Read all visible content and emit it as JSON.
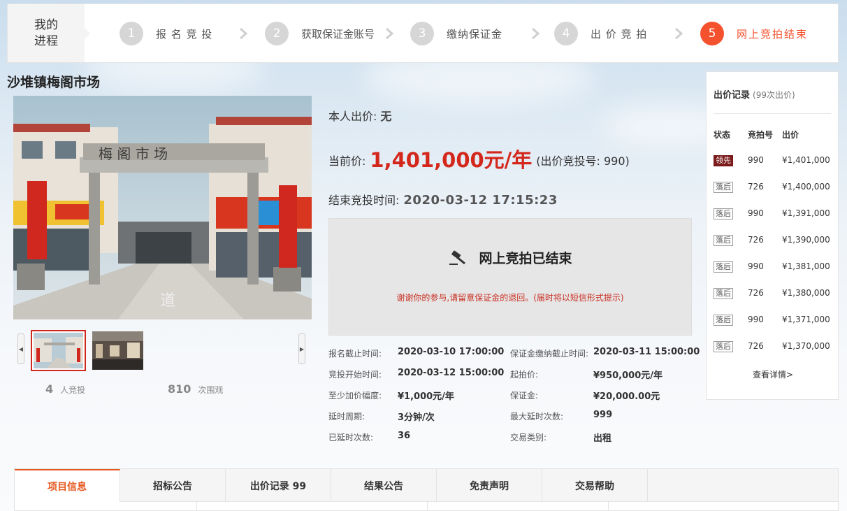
{
  "progress": {
    "heading": "我的\n进程",
    "steps": [
      {
        "num": "1",
        "label": "报 名 竞 投"
      },
      {
        "num": "2",
        "label": "获取保证金账号"
      },
      {
        "num": "3",
        "label": "缴纳保证金"
      },
      {
        "num": "4",
        "label": "出 价 竞 拍"
      },
      {
        "num": "5",
        "label": "网上竞拍结束"
      }
    ],
    "active_color": "#f4512e"
  },
  "item": {
    "title": "沙堆镇梅阁市场",
    "photo_sign": "梅 阁 市 场",
    "stats": {
      "bidders_num": "4",
      "bidders_label": "人竞投",
      "views_num": "810",
      "views_label": "次围观"
    }
  },
  "bid": {
    "my_bid_label": "本人出价:",
    "my_bid_value": "无",
    "current_label": "当前价:",
    "current_price": "1,401,000元/年",
    "current_bid_no": "(出价竞投号: 990)",
    "end_label": "结束竞投时间:",
    "end_time": "2020-03-12 17:15:23",
    "ended_title": "网上竞拍已结束",
    "ended_note": "谢谢你的参与,请留意保证金的退回。(届时将以短信形式提示)",
    "price_color": "#d4271c"
  },
  "details": [
    {
      "label": "报名截止时间:",
      "value": "2020-03-10 17:00:00"
    },
    {
      "label": "保证金缴纳截止时间:",
      "value": "2020-03-11 15:00:00"
    },
    {
      "label": "竞投开始时间:",
      "value": "2020-03-12 15:00:00"
    },
    {
      "label": "起拍价:",
      "value": "¥950,000元/年"
    },
    {
      "label": "至少加价幅度:",
      "value": "¥1,000元/年"
    },
    {
      "label": "保证金:",
      "value": "¥20,000.00元"
    },
    {
      "label": "延时周期:",
      "value": "3分钟/次"
    },
    {
      "label": "最大延时次数:",
      "value": "999"
    },
    {
      "label": "已延时次数:",
      "value": "36"
    },
    {
      "label": "交易类别:",
      "value": "出租"
    }
  ],
  "records": {
    "title": "出价记录",
    "count": "(99次出价)",
    "headers": [
      "状态",
      "竞拍号",
      "出价"
    ],
    "rows": [
      {
        "status": "领先",
        "no": "990",
        "price": "¥1,401,000"
      },
      {
        "status": "落后",
        "no": "726",
        "price": "¥1,400,000"
      },
      {
        "status": "落后",
        "no": "990",
        "price": "¥1,391,000"
      },
      {
        "status": "落后",
        "no": "726",
        "price": "¥1,390,000"
      },
      {
        "status": "落后",
        "no": "990",
        "price": "¥1,381,000"
      },
      {
        "status": "落后",
        "no": "726",
        "price": "¥1,380,000"
      },
      {
        "status": "落后",
        "no": "990",
        "price": "¥1,371,000"
      },
      {
        "status": "落后",
        "no": "726",
        "price": "¥1,370,000"
      }
    ],
    "more": "查看详情>"
  },
  "tabs": [
    "项目信息",
    "招标公告",
    "出价记录 99",
    "结果公告",
    "免责声明",
    "交易帮助"
  ]
}
